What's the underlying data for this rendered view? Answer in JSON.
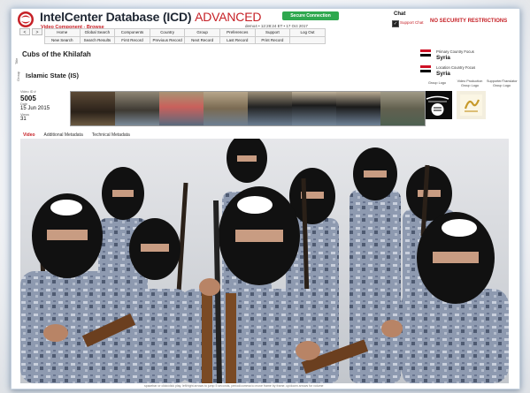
{
  "app": {
    "title": "IntelCenter Database (ICD)",
    "title_accent": "ADVANCED",
    "subtitle": "Video Component - Browse",
    "secure_button": "Secure Connection",
    "user_line": "demo4 • 12:28:24 ET • 17 Oct 2017",
    "chat_label": "Chat",
    "chat_support": "Support Chat",
    "security_notice": "NO SECURITY RESTRICTIONS",
    "colors": {
      "accent_red": "#c62026",
      "secure_green": "#2fa84f"
    }
  },
  "nav": {
    "arrows": [
      "<",
      ">"
    ],
    "row1": [
      "Home",
      "Global Search",
      "Components",
      "Country",
      "Group",
      "Preferences",
      "Support",
      "Log Out"
    ],
    "row2": [
      "New Search",
      "Search Results",
      "First Record",
      "Previous Record",
      "Next Record",
      "Last Record",
      "Print Record",
      ""
    ]
  },
  "record": {
    "title_label": "Title",
    "title": "Cubs of the Khilafah",
    "group_label": "Group",
    "group": "Islamic State (IS)",
    "video_id_label": "Video ID #",
    "video_id": "5005",
    "date_label": "Date",
    "date": "15 Jun 2015",
    "views_label": "Views",
    "views": "31"
  },
  "right_panel": {
    "primary_country_label": "Primary Country Focus",
    "primary_country": "Syria",
    "location_country_label": "Location Country Focus",
    "location_country": "Syria",
    "group_logo_label": "Group Logo",
    "production_logo_label": "Video Production Group Logo",
    "supporter_logo_label": "Supporter/Translator Group Logo"
  },
  "tabs": [
    "Video",
    "Additional Metadata",
    "Technical Metadata"
  ],
  "caption": "spacebar or click/click play, left/right arrows to jump 5 seconds, period/comma to move frame by frame, up/down arrows for volume"
}
